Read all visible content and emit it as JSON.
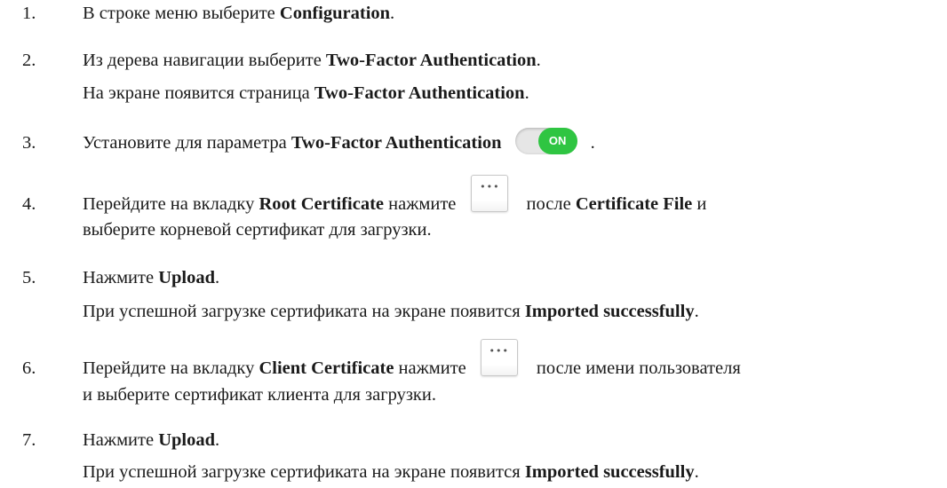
{
  "steps": [
    {
      "n": "1.",
      "pre": "В строке меню выберите ",
      "b1": "Configuration",
      "post": "."
    },
    {
      "n": "2.",
      "pre": "Из дерева навигации выберите ",
      "b1": "Two-Factor Authentication",
      "post": ".",
      "note_pre": "На экране появится страница ",
      "note_b": "Two-Factor Authentication",
      "note_post": "."
    },
    {
      "n": "3.",
      "pre": "Установите для параметра ",
      "b1": "Two-Factor Authentication",
      "post": ".",
      "toggle_label": "ON"
    },
    {
      "n": "4.",
      "pre": "Перейдите на вкладку ",
      "b1": "Root Certificate",
      "mid": " нажмите",
      "after": " после ",
      "b2": "Certificate File",
      "post": " и",
      "line2": "выберите корневой сертификат для загрузки."
    },
    {
      "n": "5.",
      "pre": "Нажмите ",
      "b1": "Upload",
      "post": ".",
      "note_pre": "При успешной загрузке сертификата на экране появится ",
      "note_b": "Imported successfully",
      "note_post": "."
    },
    {
      "n": "6.",
      "pre": "Перейдите на вкладку ",
      "b1": "Client Certificate",
      "mid": " нажмите",
      "after": " после имени пользователя",
      "line2": "и выберите сертификат клиента для загрузки."
    },
    {
      "n": "7.",
      "pre": "Нажмите ",
      "b1": "Upload",
      "post": ".",
      "note_pre": "При успешной загрузке сертификата на экране появится ",
      "note_b": "Imported successfully",
      "note_post": "."
    }
  ],
  "icons": {
    "toggle": "toggle-on-icon",
    "browse": "ellipsis-button-icon"
  }
}
